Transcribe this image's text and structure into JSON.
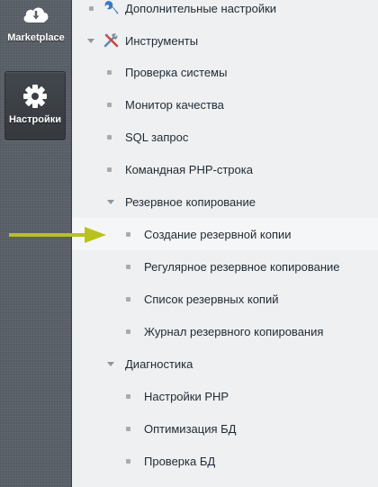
{
  "sidebar": {
    "marketplace": {
      "label": "Marketplace",
      "icon": "cloud-download-icon"
    },
    "settings": {
      "label": "Настройки",
      "icon": "gear-icon"
    }
  },
  "tree": {
    "additional_settings": {
      "label": "Дополнительные настройки",
      "icon": "wrench-icon"
    },
    "tools": {
      "label": "Инструменты",
      "icon": "tools-icon"
    },
    "system_check": {
      "label": "Проверка системы"
    },
    "quality_monitor": {
      "label": "Монитор качества"
    },
    "sql_query": {
      "label": "SQL запрос"
    },
    "php_command_line": {
      "label": "Командная PHP-строка"
    },
    "backup": {
      "label": "Резервное копирование"
    },
    "create_backup": {
      "label": "Создание резервной копии"
    },
    "scheduled_backup": {
      "label": "Регулярное резервное копирование"
    },
    "backup_list": {
      "label": "Список резервных копий"
    },
    "backup_log": {
      "label": "Журнал резервного копирования"
    },
    "diagnostics": {
      "label": "Диагностика"
    },
    "php_settings": {
      "label": "Настройки PHP"
    },
    "db_optimization": {
      "label": "Оптимизация БД"
    },
    "db_check": {
      "label": "Проверка БД"
    }
  },
  "colors": {
    "sidebar_bg": "#5a6068",
    "tree_bg": "#eef0f2",
    "active_row_bg": "#f5f6f7",
    "pointer_arrow": "#b9c21c",
    "text": "#1f2a33"
  }
}
